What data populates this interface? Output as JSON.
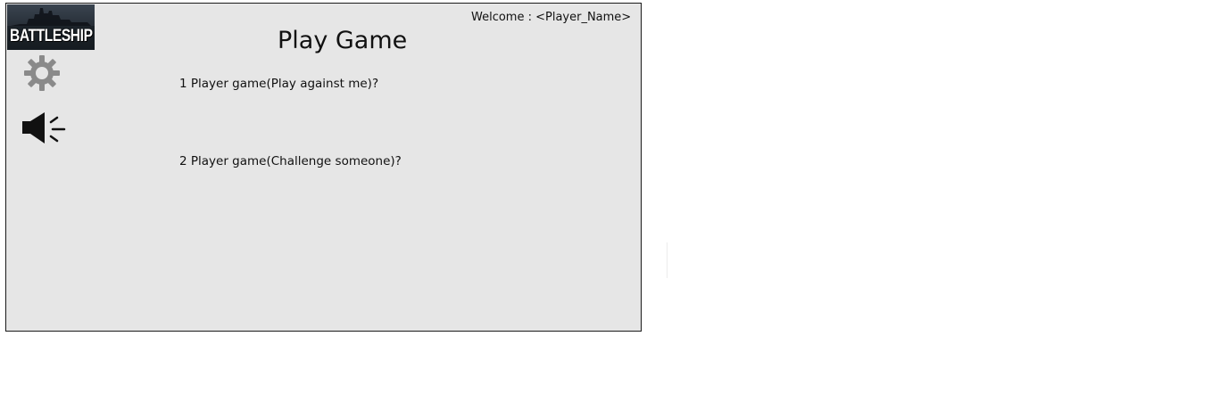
{
  "logo": {
    "text": "BATTLESHIP"
  },
  "header": {
    "welcome": "Welcome : <Player_Name>"
  },
  "main": {
    "title": "Play Game",
    "options": [
      {
        "label": "1 Player game(Play against me)?"
      },
      {
        "label": "2 Player game(Challenge someone)?"
      }
    ]
  },
  "toolbar": {
    "settings_icon": "gear-icon",
    "sound_icon": "speaker-icon"
  },
  "colors": {
    "panel_background": "#e6e6e6",
    "panel_border": "#1a1a1a",
    "icon_gray": "#8a8a8a",
    "icon_black": "#111111"
  }
}
